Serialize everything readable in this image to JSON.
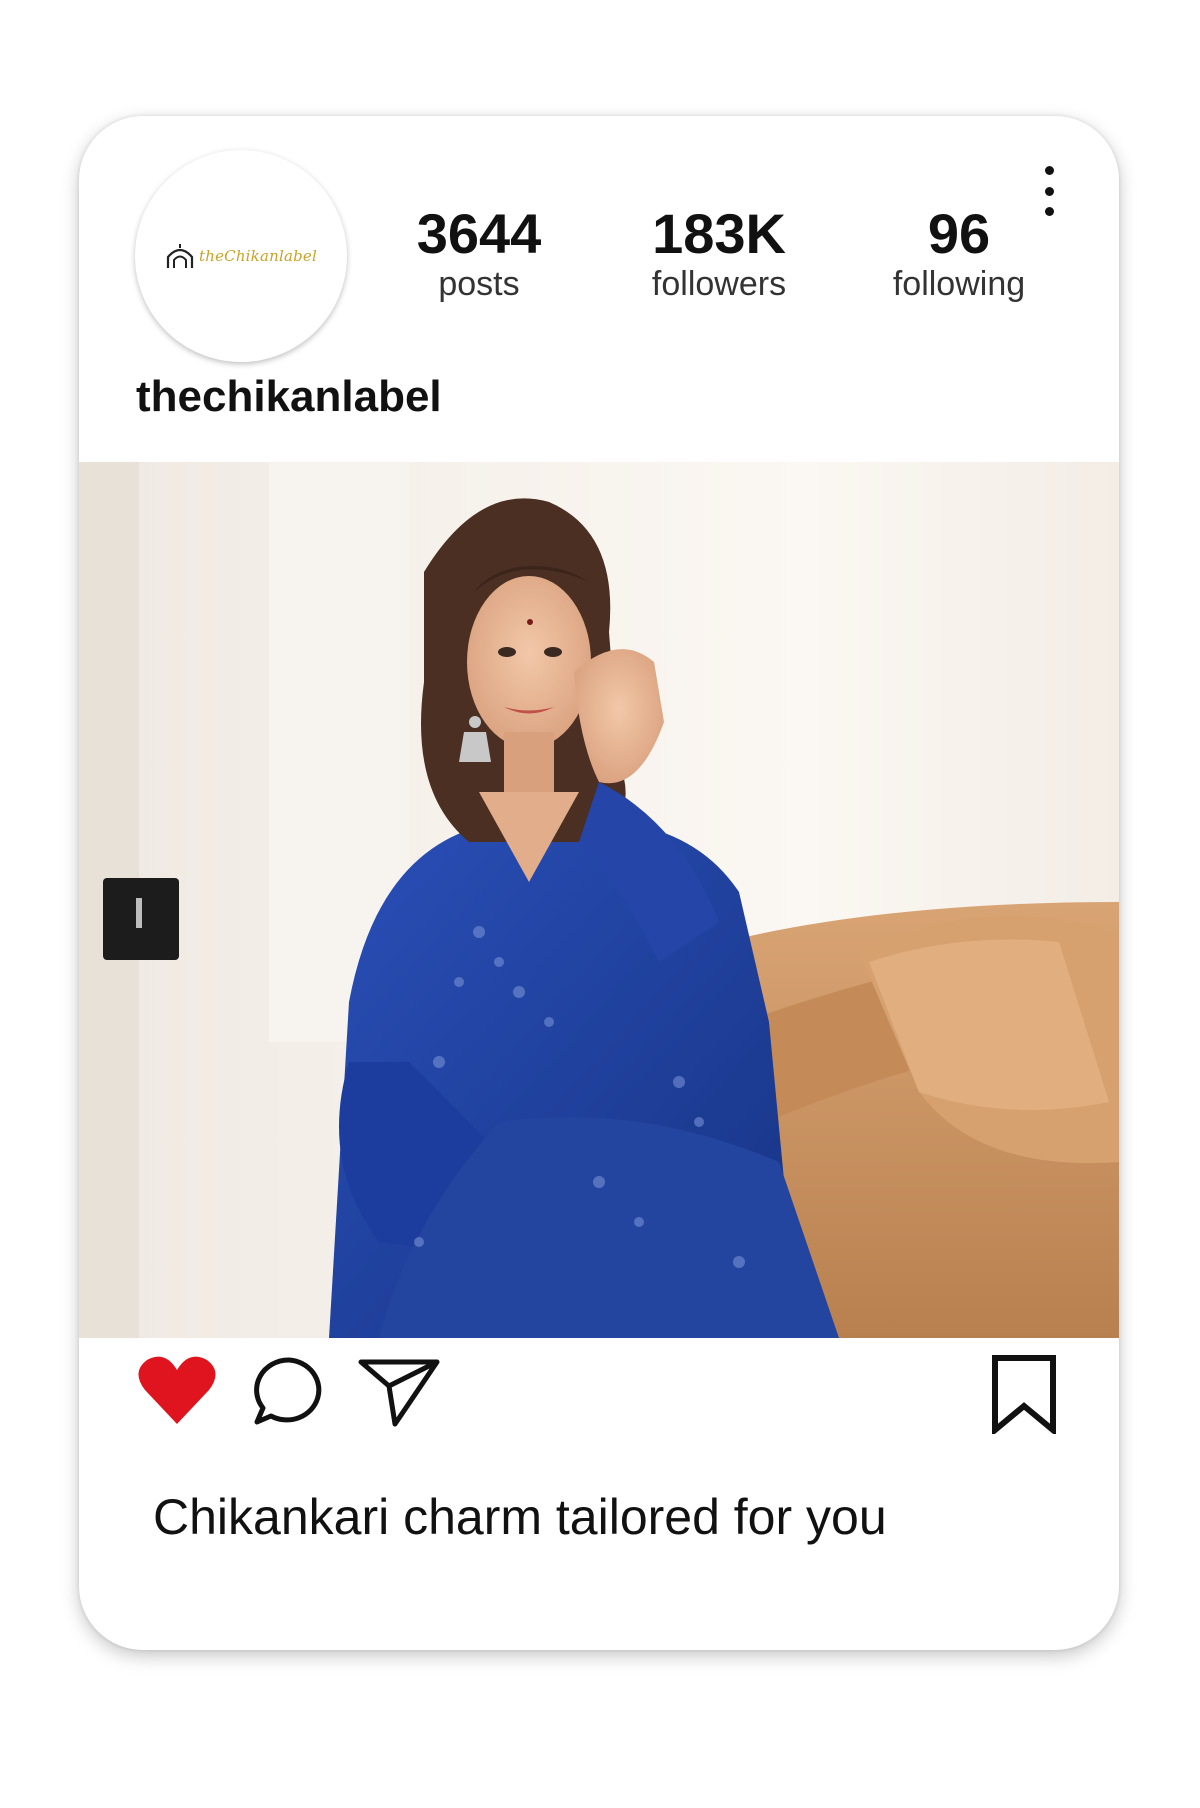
{
  "profile": {
    "logo_text": "theChikanlabel",
    "username": "thechikanlabel",
    "stats": {
      "posts": {
        "value": "3644",
        "label": "posts"
      },
      "followers": {
        "value": "183K",
        "label": "followers"
      },
      "following": {
        "value": "96",
        "label": "following"
      }
    }
  },
  "post": {
    "caption": "Chikankari charm tailored for you",
    "liked": true
  },
  "colors": {
    "like": "#e0141e",
    "logo_gold": "#c9a227",
    "kurta_blue": "#1f3f9c",
    "sofa": "#d39a66"
  },
  "icons": [
    "more-vertical-icon",
    "heart-icon",
    "comment-icon",
    "share-icon",
    "bookmark-icon"
  ]
}
